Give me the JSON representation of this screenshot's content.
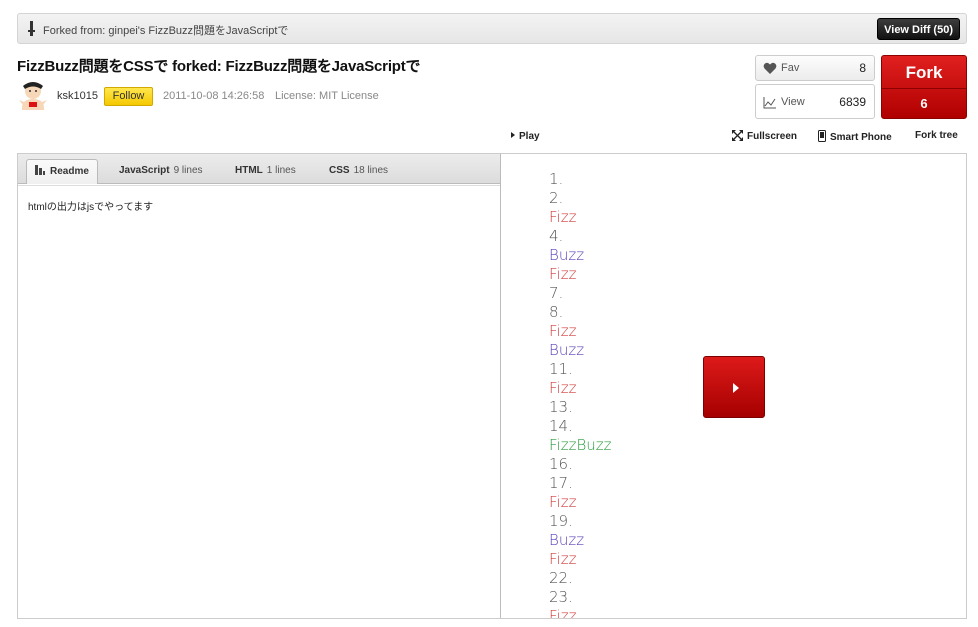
{
  "forkbar": {
    "text": "Forked from: ginpei's FizzBuzz問題をJavaScriptで",
    "view_diff": "View Diff (50)"
  },
  "header": {
    "title": "FizzBuzz問題をCSSで forked: FizzBuzz問題をJavaScriptで",
    "username": "ksk1015",
    "follow_label": "Follow",
    "date": "2011-10-08 14:26:58",
    "license": "License: MIT License"
  },
  "stats": {
    "fav_label": "Fav",
    "fav_count": "8",
    "view_label": "View",
    "view_count": "6839",
    "fork_label": "Fork",
    "fork_count": "6"
  },
  "toolbar": {
    "play": "Play",
    "fullscreen": "Fullscreen",
    "smartphone": "Smart Phone",
    "forktree": "Fork tree"
  },
  "tabs": [
    {
      "label": "Readme",
      "count": ""
    },
    {
      "label": "JavaScript",
      "count": "9 lines"
    },
    {
      "label": "HTML",
      "count": "1 lines"
    },
    {
      "label": "CSS",
      "count": "18 lines"
    }
  ],
  "readme": {
    "text": "htmlの出力はjsでやってます"
  },
  "output": [
    "1.",
    "2.",
    "Fizz",
    "4.",
    "Buzz",
    "Fizz",
    "7.",
    "8.",
    "Fizz",
    "Buzz",
    "11.",
    "Fizz",
    "13.",
    "14.",
    "FizzBuzz",
    "16.",
    "17.",
    "Fizz",
    "19.",
    "Buzz",
    "Fizz",
    "22.",
    "23.",
    "Fizz"
  ],
  "colors": {
    "fork_red": "#c80000",
    "follow_yellow": "#f5c800",
    "fizz": "#d13a3a",
    "buzz": "#5b3fb8",
    "fizzbuzz": "#2a9a3a"
  }
}
